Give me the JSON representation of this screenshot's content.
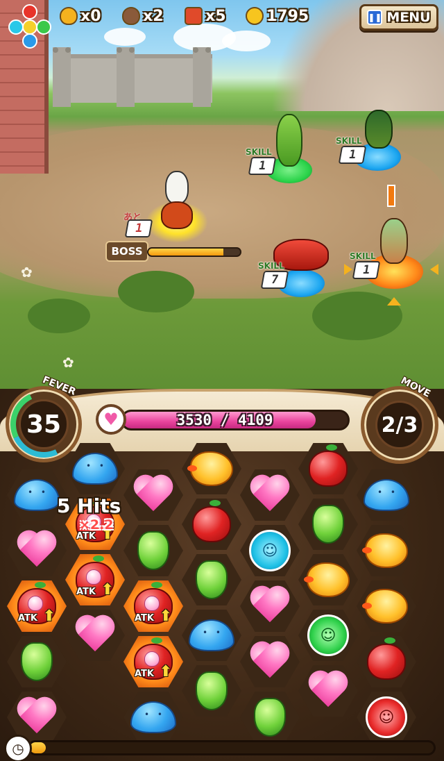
{
  "hud": {
    "elements_icon": "element-cycle-icon",
    "items": [
      {
        "name": "gold-egg",
        "icon": "egg-gold-icon",
        "color": "#f5b21e",
        "value": "x0"
      },
      {
        "name": "brown-egg",
        "icon": "egg-brown-icon",
        "color": "#8a5a3a",
        "value": "x2"
      },
      {
        "name": "treasure",
        "icon": "treasure-chest-icon",
        "color": "#e04a2a",
        "value": "x5"
      },
      {
        "name": "coins",
        "icon": "coin-icon",
        "color": "#f7c51f",
        "value": "1795"
      }
    ],
    "menu_label": "MENU"
  },
  "battle": {
    "boss": {
      "label": "BOSS",
      "turns_label": "あと",
      "turns": "1",
      "hp_fraction": 0.82
    },
    "allies": [
      {
        "id": "cactus",
        "skill_label": "SKILL",
        "skill_value": "1",
        "base_color": "#2bd34a"
      },
      {
        "id": "bird",
        "skill_label": "SKILL",
        "skill_value": "1",
        "base_color": "#1aa5f0"
      },
      {
        "id": "fish",
        "skill_label": "SKILL",
        "skill_value": "7",
        "base_color": "#1aa5f0"
      },
      {
        "id": "chef",
        "skill_label": "SKILL",
        "skill_value": "1",
        "base_color": "#ff8a1a"
      }
    ]
  },
  "panel": {
    "fever_label": "FEVER",
    "fever_value": "35",
    "move_label": "MOVE",
    "move_value": "2/3",
    "hp_text": "3530 / 4109",
    "hp_fraction": 0.859,
    "combo_hits": "5 Hits",
    "combo_multiplier": "×2.2",
    "atk_label": "ATK",
    "timer_fraction": 0.04
  },
  "board": {
    "columns": [
      [
        "slime",
        "heart",
        "apple-atk",
        "bean",
        "heart"
      ],
      [
        "slime",
        "apple-atk",
        "apple-atk",
        "heart"
      ],
      [
        "heart",
        "bean",
        "apple-atk",
        "apple-atk",
        "slime"
      ],
      [
        "duck",
        "apple",
        "bean",
        "slime",
        "bean"
      ],
      [
        "heart",
        "coin-blue",
        "heart",
        "heart",
        "bean"
      ],
      [
        "apple",
        "bean",
        "duck",
        "coin-green",
        "heart"
      ],
      [
        "slime",
        "duck",
        "duck",
        "apple",
        "coin-red"
      ]
    ]
  }
}
